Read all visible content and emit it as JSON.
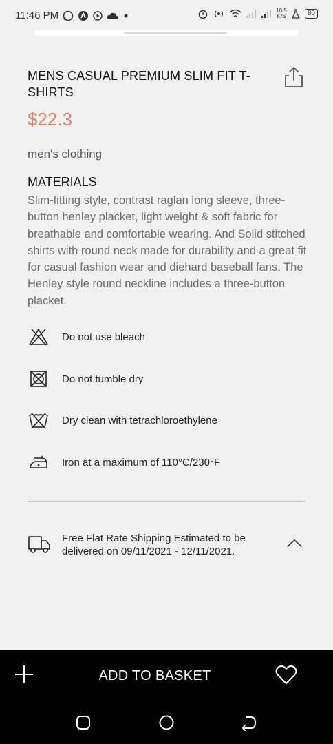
{
  "status": {
    "time": "11:46 PM",
    "net_speed_top": "10.5",
    "net_speed_bottom": "K/S",
    "battery": "80"
  },
  "product": {
    "title": "MENS CASUAL PREMIUM SLIM FIT T-SHIRTS",
    "price": "$22.3",
    "category": "men's clothing",
    "materials_heading": "MATERIALS",
    "materials_text": "Slim-fitting style, contrast raglan long sleeve, three-button henley placket, light weight & soft fabric for breathable and comfortable wearing. And Solid stitched shirts with round neck made for durability and a great fit for casual fashion wear and diehard baseball fans. The Henley style round neckline includes a three-button placket."
  },
  "care": [
    {
      "icon": "no-bleach-icon",
      "label": "Do not use bleach"
    },
    {
      "icon": "no-tumble-dry-icon",
      "label": "Do not tumble dry"
    },
    {
      "icon": "dry-clean-icon",
      "label": "Dry clean with tetrachloroethylene"
    },
    {
      "icon": "iron-icon",
      "label": "Iron at a maximum of 110°C/230°F"
    }
  ],
  "shipping": {
    "icon": "delivery-truck-icon",
    "text": "Free Flat Rate Shipping Estimated to be delivered on 09/11/2021 - 12/11/2021."
  },
  "bottom": {
    "add_to_basket": "ADD TO BASKET"
  },
  "colors": {
    "price": "#e0825f",
    "bottom_bar": "#000000",
    "background": "#f1f1f1"
  }
}
